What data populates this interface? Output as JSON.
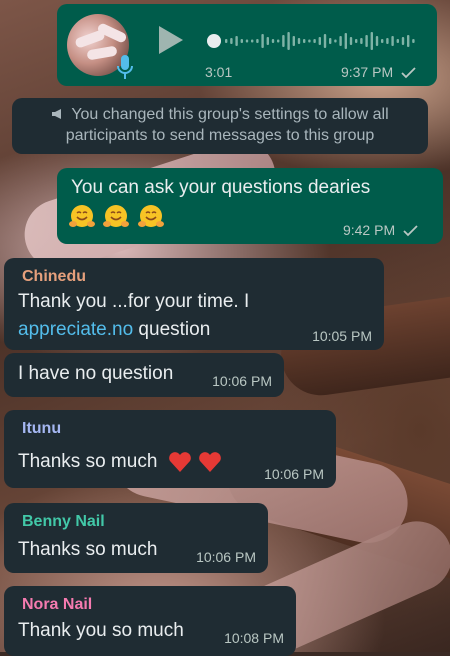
{
  "voice_note": {
    "duration": "3:01",
    "time": "9:37 PM",
    "status": "double-check-icon"
  },
  "system_message": {
    "text": "You changed this group's settings to allow all participants to send messages to this group"
  },
  "outgoing": {
    "text": "You can ask your questions dearies",
    "emojis": [
      "hugging-face-emoji",
      "hugging-face-emoji",
      "hugging-face-emoji"
    ],
    "time": "9:42 PM"
  },
  "messages": [
    {
      "sender": "Chinedu",
      "sender_color": "#e6a07c",
      "text_line1": "Thank you ...for your time. I",
      "link": "appreciate.no",
      "text_after_link": " question",
      "time": "10:05 PM"
    },
    {
      "text": "I have no question",
      "time": "10:06 PM"
    },
    {
      "sender": "Itunu",
      "sender_color": "#a5b7f2",
      "text": "Thanks so much",
      "emojis": [
        "red-heart-emoji",
        "red-heart-emoji"
      ],
      "time": "10:06 PM"
    },
    {
      "sender": "Benny Nail",
      "sender_color": "#42c8a8",
      "text": "Thanks so much",
      "time": "10:06 PM"
    },
    {
      "sender": "Nora Nail",
      "sender_color": "#f57bb0",
      "text": "Thank you so much",
      "time": "10:08 PM"
    }
  ]
}
